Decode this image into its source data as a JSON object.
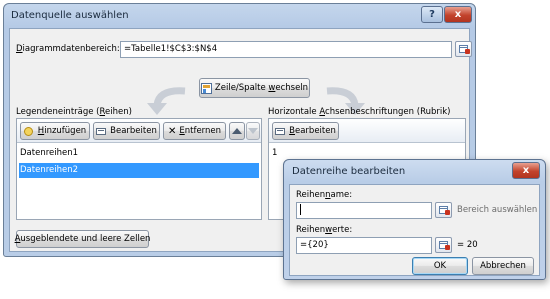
{
  "main_dialog": {
    "title": "Datenquelle auswählen",
    "help_glyph": "?",
    "close_glyph": "x",
    "range_label_pre": "D",
    "range_label_acc": "i",
    "range_label_post": "agrammdatenbereich:",
    "range_value": "=Tabelle1!$C$3:$N$4",
    "switch_pre": "Zeile/Spalte ",
    "switch_acc": "w",
    "switch_post": "echseln",
    "legend_label_pre": "Legendeneinträge (",
    "legend_label_acc": "R",
    "legend_label_post": "eihen)",
    "axis_label_pre": "Horizontale ",
    "axis_label_acc": "A",
    "axis_label_post": "chsenbeschriftungen (Rubrik)",
    "add_pre": "",
    "add_acc": "H",
    "add_post": "inzufügen",
    "edit_label": "Bearbeiten",
    "remove_pre": "",
    "remove_acc": "E",
    "remove_post": "ntfernen",
    "axis_edit_pre": "",
    "axis_edit_acc": "B",
    "axis_edit_post": "earbeiten",
    "series": [
      {
        "label": "Datenreihen1",
        "selected": false
      },
      {
        "label": "Datenreihen2",
        "selected": true
      }
    ],
    "axis_items": [
      "1"
    ],
    "hidden_pre": "",
    "hidden_acc": "A",
    "hidden_post": "usgeblendete und leere Zellen"
  },
  "series_dialog": {
    "title": "Datenreihe bearbeiten",
    "close_glyph": "x",
    "name_label_pre": "Reihen",
    "name_label_acc": "n",
    "name_label_post": "ame:",
    "name_value": "",
    "name_hint": "Bereich auswählen",
    "values_label_pre": "Reihen",
    "values_label_acc": "w",
    "values_label_post": "erte:",
    "values_value": "={20}",
    "values_result": "= 20",
    "ok_label": "OK",
    "cancel_label": "Abbrechen"
  },
  "colors": {
    "selection": "#3399ff",
    "title_bar": "#b9cde7",
    "close_button": "#c2432c"
  }
}
